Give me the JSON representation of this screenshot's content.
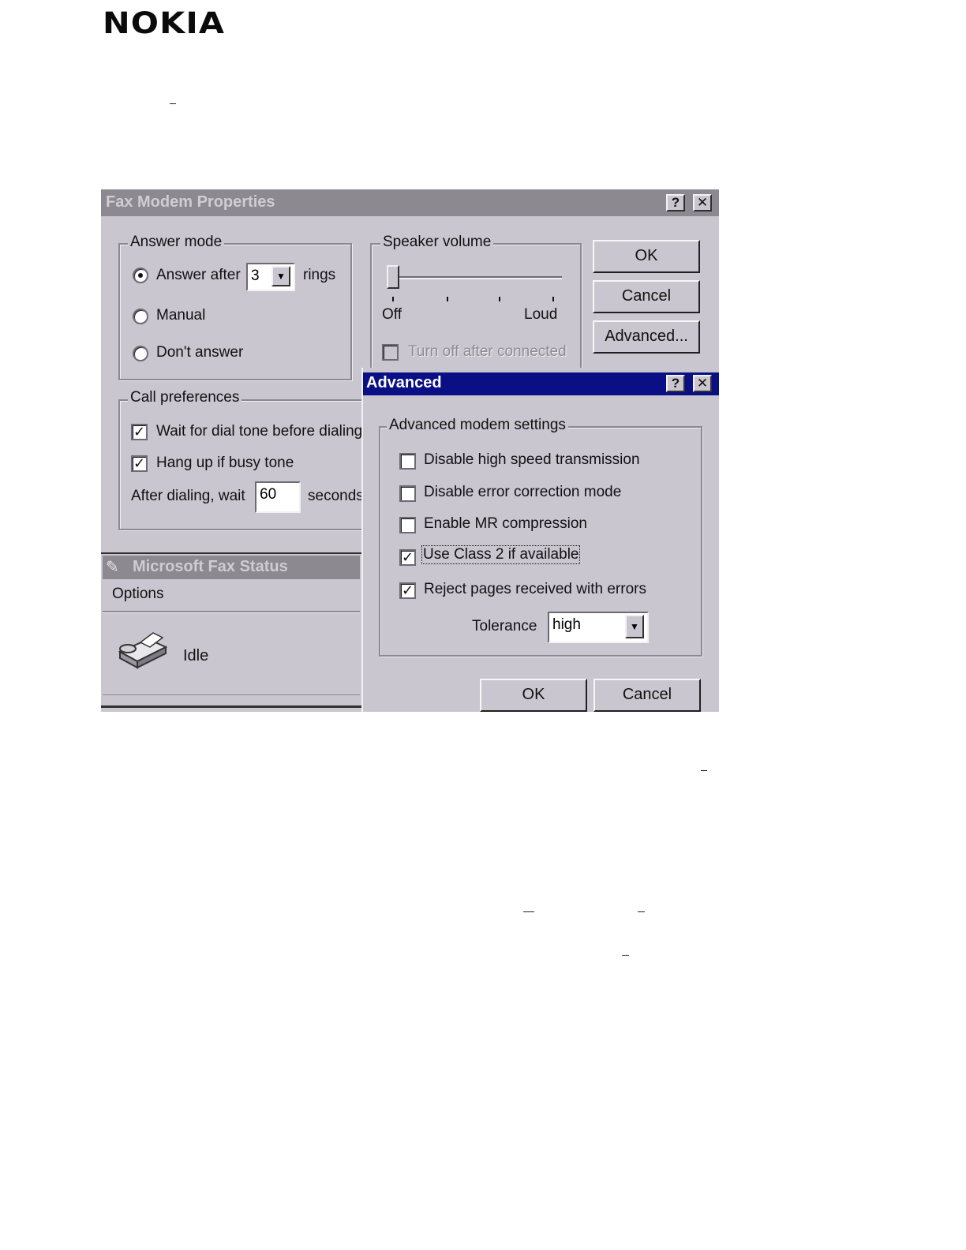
{
  "logo": {
    "text": "NOKIA"
  },
  "fax_modem_properties": {
    "title": "Fax Modem Properties",
    "help_button": "?",
    "close_button": "✕",
    "answer_mode": {
      "legend": "Answer mode",
      "answer_after_label": "Answer after",
      "rings_value": "3",
      "rings_label": "rings",
      "manual_label": "Manual",
      "dont_answer_label": "Don't answer",
      "selected": "answer_after"
    },
    "speaker_volume": {
      "legend": "Speaker volume",
      "off_label": "Off",
      "loud_label": "Loud",
      "level": 0,
      "turn_off_label": "Turn off after connected",
      "turn_off_checked": false
    },
    "buttons": {
      "ok": "OK",
      "cancel": "Cancel",
      "advanced": "Advanced..."
    },
    "call_preferences": {
      "legend": "Call preferences",
      "wait_dial_tone_label": "Wait for dial tone before dialing",
      "wait_dial_tone_checked": true,
      "hang_up_label": "Hang up if busy tone",
      "hang_up_checked": true,
      "after_dialing_label": "After dialing, wait",
      "wait_seconds": "60",
      "seconds_label": "seconds"
    }
  },
  "fax_status": {
    "title": "Microsoft Fax Status",
    "menu_options": "Options",
    "status_text": "Idle"
  },
  "advanced_dialog": {
    "title": "Advanced",
    "help_button": "?",
    "close_button": "✕",
    "group_legend": "Advanced  modem settings",
    "options": [
      {
        "label": "Disable high speed transmission",
        "checked": false
      },
      {
        "label": "Disable error correction mode",
        "checked": false
      },
      {
        "label": "Enable MR compression",
        "checked": false
      },
      {
        "label": "Use Class 2 if available",
        "checked": true
      },
      {
        "label": "Reject pages received with errors",
        "checked": true
      }
    ],
    "tolerance_label": "Tolerance",
    "tolerance_value": "high",
    "ok": "OK",
    "cancel": "Cancel"
  }
}
